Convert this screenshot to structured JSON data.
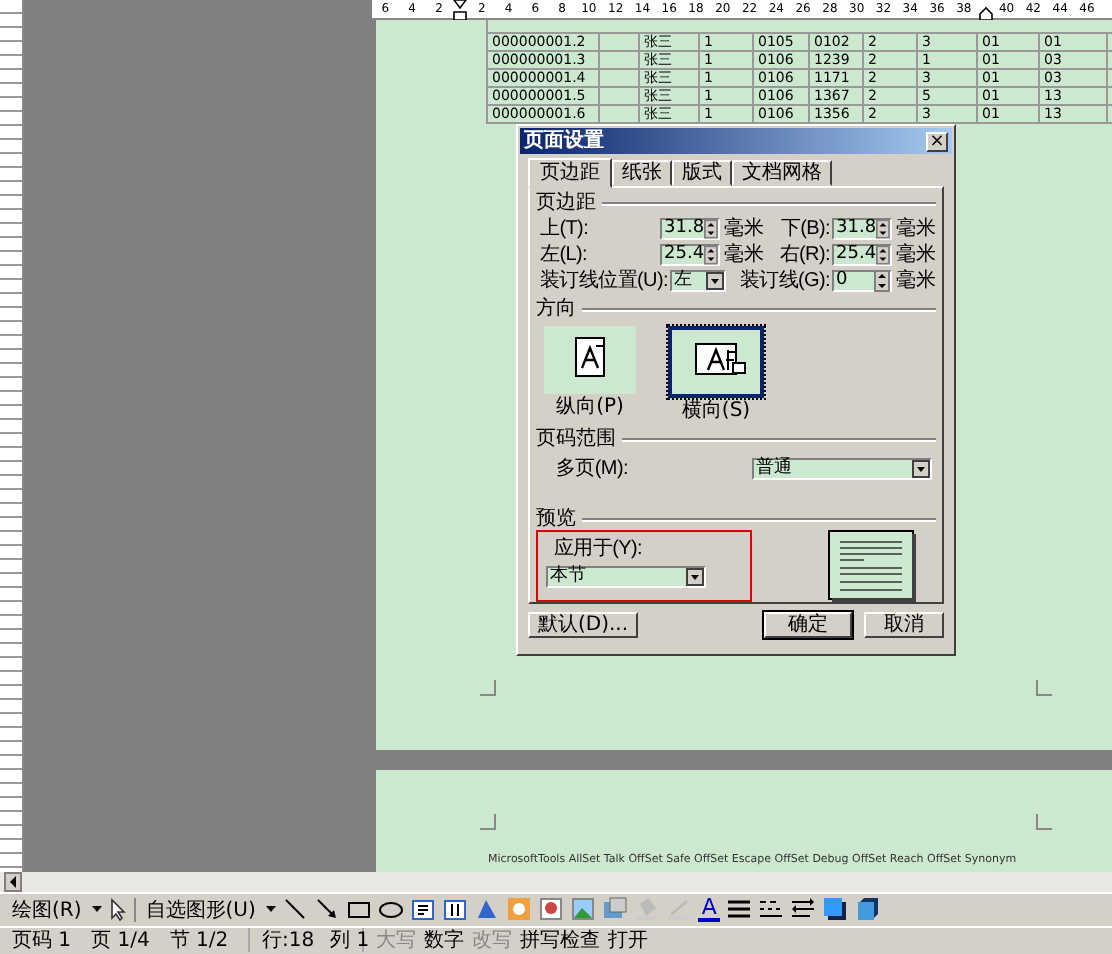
{
  "ruler": {
    "labels": [
      "6",
      "4",
      "2",
      "2",
      "4",
      "6",
      "8",
      "10",
      "12",
      "14",
      "16",
      "18",
      "20",
      "22",
      "24",
      "26",
      "28",
      "30",
      "32",
      "34",
      "36",
      "38",
      "40",
      "42",
      "44",
      "46"
    ]
  },
  "table": {
    "rows": [
      [
        "000000001.2",
        "",
        "张三",
        "1",
        "0105",
        "0102",
        "2",
        "3",
        "01",
        "01"
      ],
      [
        "000000001.3",
        "",
        "张三",
        "1",
        "0106",
        "1239",
        "2",
        "1",
        "01",
        "03"
      ],
      [
        "000000001.4",
        "",
        "张三",
        "1",
        "0106",
        "1171",
        "2",
        "3",
        "01",
        "03"
      ],
      [
        "000000001.5",
        "",
        "张三",
        "1",
        "0106",
        "1367",
        "2",
        "5",
        "01",
        "13"
      ],
      [
        "000000001.6",
        "",
        "张三",
        "1",
        "0106",
        "1356",
        "2",
        "3",
        "01",
        "13"
      ]
    ]
  },
  "dialog": {
    "title": "页面设置",
    "close": "×",
    "tabs": [
      {
        "label": "页边距",
        "selected": true
      },
      {
        "label": "纸张",
        "selected": false
      },
      {
        "label": "版式",
        "selected": false
      },
      {
        "label": "文档网格",
        "selected": false
      }
    ],
    "margins": {
      "heading": "页边距",
      "fields": [
        {
          "kind": "spin",
          "label": "上(T):",
          "value": "31.8",
          "unit": "毫米"
        },
        {
          "kind": "spin",
          "label": "下(B):",
          "value": "31.8",
          "unit": "毫米"
        },
        {
          "kind": "spin",
          "label": "左(L):",
          "value": "25.4",
          "unit": "毫米"
        },
        {
          "kind": "spin",
          "label": "右(R):",
          "value": "25.4",
          "unit": "毫米"
        },
        {
          "kind": "dropdown",
          "label": "装订线位置(U):",
          "value": "左"
        },
        {
          "kind": "spin",
          "label": "装订线(G):",
          "value": "0",
          "unit": "毫米"
        }
      ]
    },
    "orientation": {
      "heading": "方向",
      "options": [
        {
          "label": "纵向(P)",
          "selected": false
        },
        {
          "label": "横向(S)",
          "selected": true
        }
      ]
    },
    "pages": {
      "heading": "页码范围",
      "label": "多页(M):",
      "value": "普通"
    },
    "preview": {
      "heading": "预览",
      "apply_label": "应用于(Y):",
      "apply_value": "本节",
      "highlighted": true
    },
    "buttons": [
      {
        "label": "默认(D)...",
        "default": false
      },
      {
        "label": "确定",
        "default": true
      },
      {
        "label": "取消",
        "default": false
      }
    ]
  },
  "footer_text": "MicrosoftTools AllSet Talk OffSet Safe OffSet Escape OffSet Debug OffSet Reach OffSet Synonym",
  "draw_toolbar": {
    "draw_menu": "绘图(R)",
    "autoshapes": "自选图形(U)",
    "font_color_glyph": "A"
  },
  "status_bar": {
    "sections": [
      [
        {
          "text": "页码 1",
          "disabled": false
        },
        {
          "text": "页 1/4",
          "disabled": false
        },
        {
          "text": "节 1/2",
          "disabled": false
        }
      ],
      [
        {
          "text": "行:18",
          "disabled": false
        },
        {
          "text": "列 1",
          "disabled": false
        }
      ],
      [
        {
          "text": "大写",
          "disabled": true
        },
        {
          "text": "数字",
          "disabled": false
        },
        {
          "text": "改写",
          "disabled": true
        },
        {
          "text": "拼写检查",
          "disabled": false
        },
        {
          "text": "打开",
          "disabled": false
        }
      ]
    ]
  }
}
